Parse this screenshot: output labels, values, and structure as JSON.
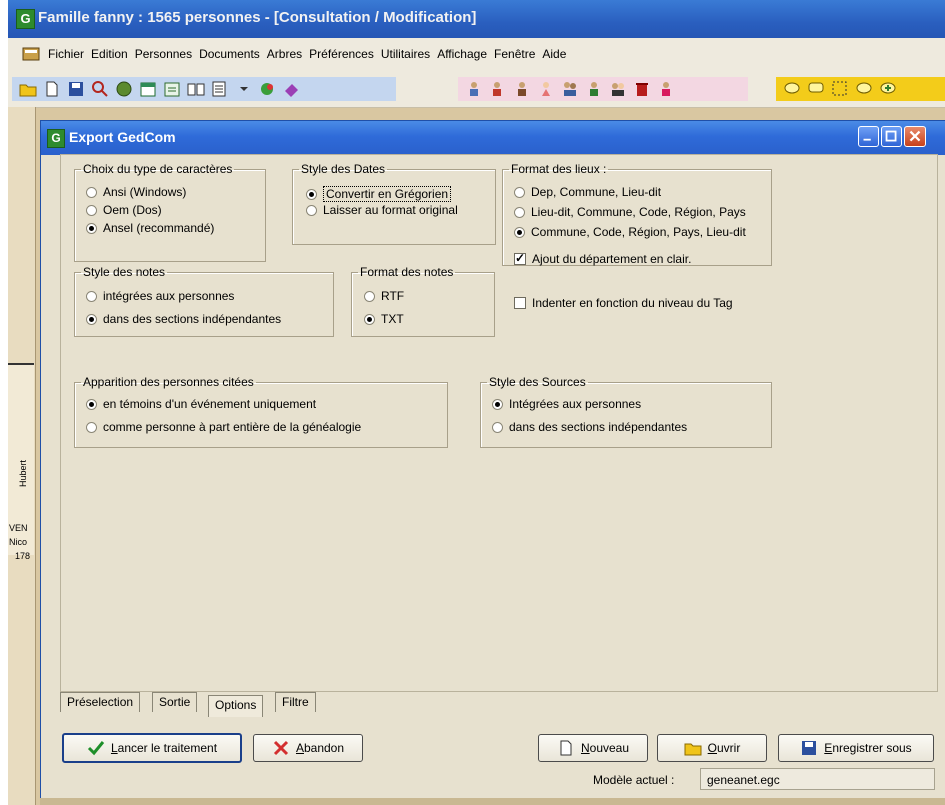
{
  "app": {
    "title": "Famille fanny : 1565 personnes - [Consultation / Modification]",
    "menu": [
      "Fichier",
      "Edition",
      "Personnes",
      "Documents",
      "Arbres",
      "Préférences",
      "Utilitaires",
      "Affichage",
      "Fenêtre",
      "Aide"
    ],
    "background_labels": {
      "name1": "Hubert",
      "name2": "VEN",
      "name3": "Nico",
      "year": "178"
    }
  },
  "dialog": {
    "title": "Export GedCom",
    "charset": {
      "legend": "Choix du type de caractères",
      "options": [
        "Ansi (Windows)",
        "Oem (Dos)",
        "Ansel (recommandé)"
      ],
      "selected": 2
    },
    "dates": {
      "legend": "Style des Dates",
      "options": [
        "Convertir en Grégorien",
        "Laisser au format original"
      ],
      "selected": 0
    },
    "places": {
      "legend": "Format des lieux :",
      "options": [
        "Dep, Commune, Lieu-dit",
        "Lieu-dit, Commune, Code, Région, Pays",
        "Commune, Code, Région, Pays, Lieu-dit"
      ],
      "selected": 2
    },
    "checks": {
      "departement": {
        "label": "Ajout du département en clair.",
        "checked": true
      },
      "indent": {
        "label": "Indenter en fonction du niveau du Tag",
        "checked": false
      }
    },
    "notes_style": {
      "legend": "Style des notes",
      "options": [
        "intégrées aux personnes",
        "dans des sections indépendantes"
      ],
      "selected": 1
    },
    "notes_format": {
      "legend": "Format des notes",
      "options": [
        "RTF",
        "TXT"
      ],
      "selected": 1
    },
    "persons_cited": {
      "legend": "Apparition des personnes citées",
      "options": [
        "en témoins d'un événement uniquement",
        "comme personne à part entière de la généalogie"
      ],
      "selected": 0
    },
    "sources": {
      "legend": "Style des Sources",
      "options": [
        "Intégrées aux personnes",
        "dans des sections indépendantes"
      ],
      "selected": 0
    },
    "tabs": [
      "Préselection",
      "Sortie",
      "Options",
      "Filtre"
    ],
    "active_tab": "Options",
    "buttons": {
      "run": "Lancer le traitement",
      "abort": "Abandon",
      "new": "Nouveau",
      "open": "Ouvrir",
      "save_as": "Enregistrer sous"
    },
    "model": {
      "label": "Modèle actuel :",
      "value": "geneanet.egc"
    }
  }
}
